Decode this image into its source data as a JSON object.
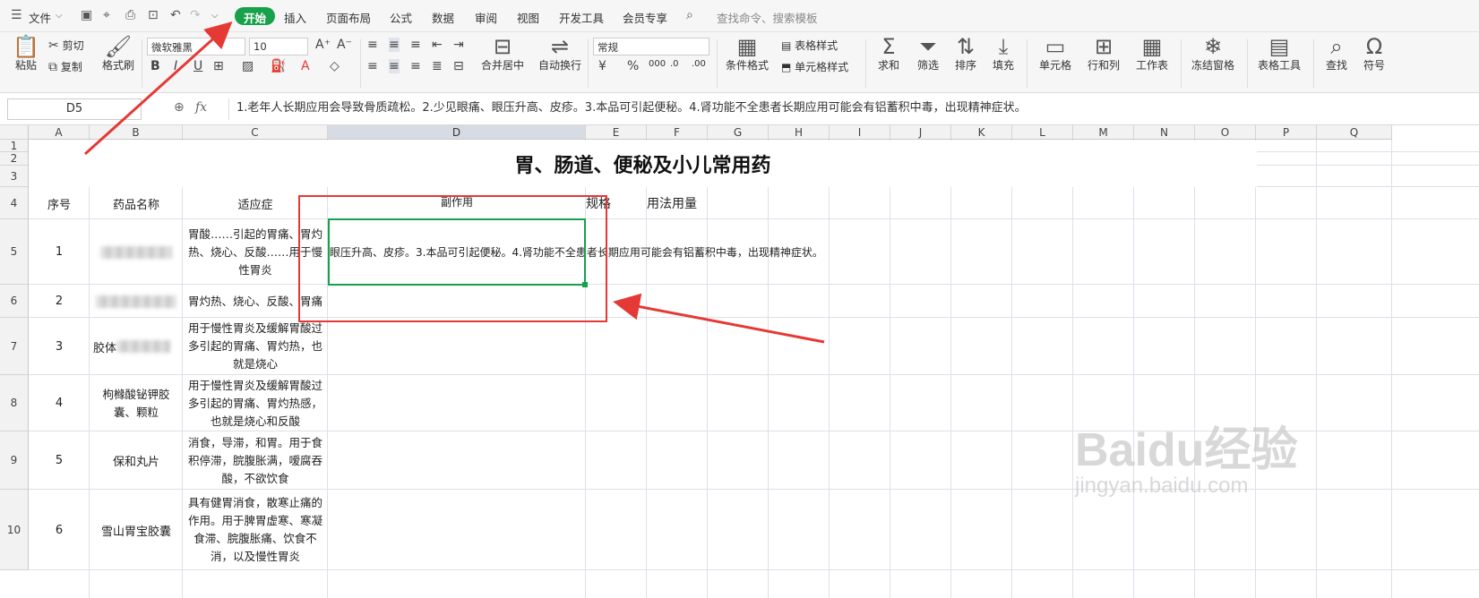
{
  "menubar": {
    "file_label": "文件",
    "tabs": [
      "开始",
      "插入",
      "页面布局",
      "公式",
      "数据",
      "审阅",
      "视图",
      "开发工具",
      "会员专享"
    ],
    "active_tab": "开始",
    "search_placeholder": "查找命令、搜索模板"
  },
  "ribbon": {
    "paste": "粘贴",
    "cut": "剪切",
    "copy": "复制",
    "format_painter": "格式刷",
    "font_name": "微软雅黑",
    "font_size": "10",
    "merge_center": "合并居中",
    "auto_wrap": "自动换行",
    "number_format": "常规",
    "cond_format": "条件格式",
    "table_style": "表格样式",
    "cell_style": "单元格样式",
    "sum": "求和",
    "filter": "筛选",
    "sort": "排序",
    "fill": "填充",
    "cell": "单元格",
    "row_col": "行和列",
    "worksheet": "工作表",
    "freeze": "冻结窗格",
    "table_tools": "表格工具",
    "find": "查找",
    "symbol": "符号"
  },
  "formula_bar": {
    "cell_ref": "D5",
    "fx": "fx",
    "content": "1.老年人长期应用会导致骨质疏松。2.少见眼痛、眼压升高、皮疹。3.本品可引起便秘。4.肾功能不全患者长期应用可能会有铝蓄积中毒，出现精神症状。"
  },
  "sheet": {
    "columns": [
      "A",
      "B",
      "C",
      "D",
      "E",
      "F",
      "G",
      "H",
      "I",
      "J",
      "K",
      "L",
      "M",
      "N",
      "O",
      "P",
      "Q"
    ],
    "selected_column": "D",
    "rows": [
      "1",
      "2",
      "3",
      "4",
      "5",
      "6",
      "7",
      "8",
      "9",
      "10"
    ],
    "title": "胃、肠道、便秘及小儿常用药",
    "headers": {
      "a": "序号",
      "b": "药品名称",
      "c": "适应症",
      "d": "副作用",
      "e": "规格",
      "f": "用法用量"
    },
    "data_rows": [
      {
        "no": "1",
        "name": "",
        "indication": "胃酸……引起的胃痛、胃灼热、烧心、反酸……用于慢性胃炎",
        "side_effect": "眼压升高、皮疹。3.本品可引起便秘。4.肾功能不全患者长期应用可能会有铝蓄积中毒，出现精神症状。"
      },
      {
        "no": "2",
        "name": "",
        "indication": "胃灼热、烧心、反酸、胃痛",
        "side_effect": ""
      },
      {
        "no": "3",
        "name": "胶体",
        "indication": "用于慢性胃炎及缓解胃酸过多引起的胃痛、胃灼热，也就是烧心",
        "side_effect": ""
      },
      {
        "no": "4",
        "name": "枸橼酸铋钾胶囊、颗粒",
        "indication": "用于慢性胃炎及缓解胃酸过多引起的胃痛、胃灼热感，也就是烧心和反酸",
        "side_effect": ""
      },
      {
        "no": "5",
        "name": "保和丸片",
        "indication": "消食，导滞，和胃。用于食积停滞，脘腹胀满，嗳腐吞酸，不欲饮食",
        "side_effect": ""
      },
      {
        "no": "6",
        "name": "雪山胃宝胶囊",
        "indication": "具有健胃消食，散寒止痛的作用。用于脾胃虚寒、寒凝食滞、脘腹胀痛、饮食不消，以及慢性胃炎",
        "side_effect": ""
      }
    ]
  },
  "watermark": {
    "brand": "Baidu经验",
    "url": "jingyan.baidu.com"
  },
  "colors": {
    "accent": "#17a14b",
    "annotation": "#e53935"
  }
}
